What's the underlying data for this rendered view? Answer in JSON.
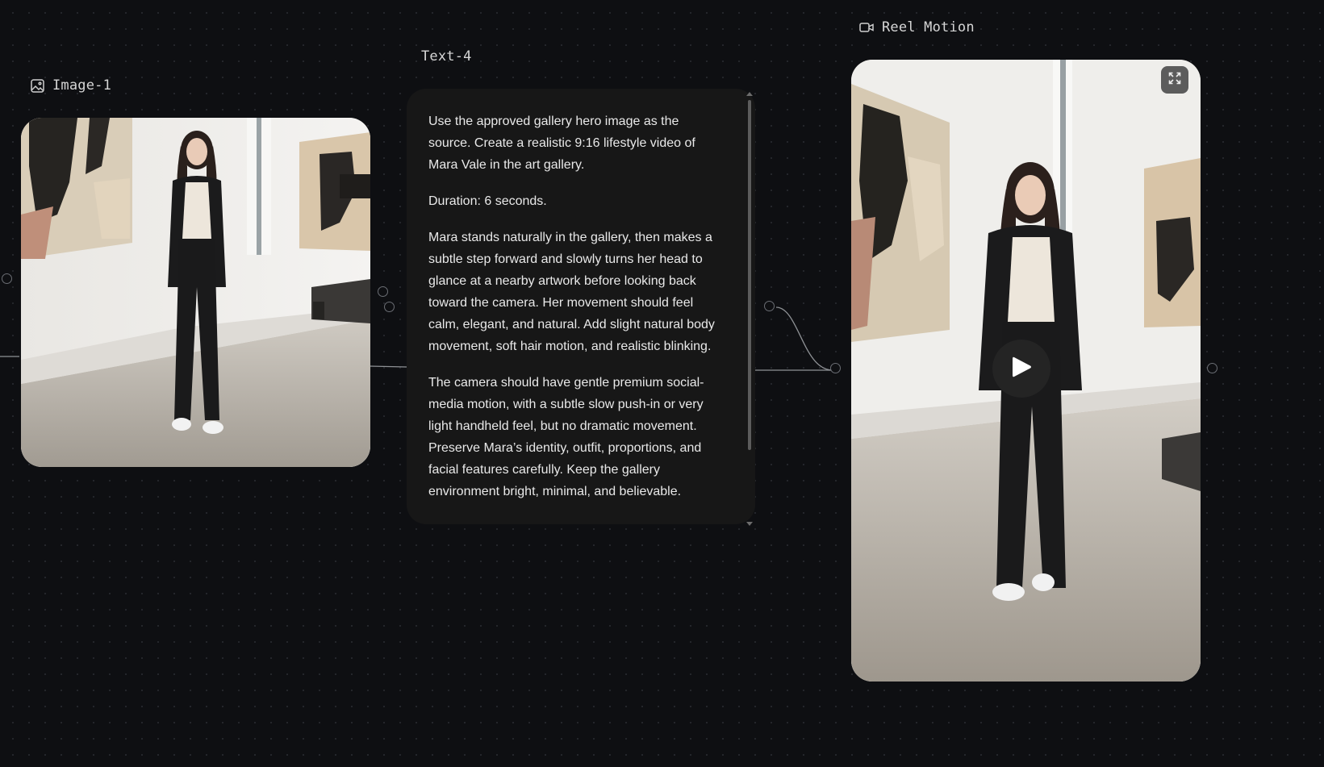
{
  "nodes": {
    "image1": {
      "title": "Image-1",
      "icon": "image-icon"
    },
    "text4": {
      "title": "Text-4",
      "paragraphs": [
        "Use the approved gallery hero image as the source. Create a realistic 9:16 lifestyle video of Mara Vale in the art gallery.",
        "Duration: 6 seconds.",
        "Mara stands naturally in the gallery, then makes a subtle step forward and slowly turns her head to glance at a nearby artwork before looking back toward the camera. Her movement should feel calm, elegant, and natural. Add slight natural body movement, soft hair motion, and realistic blinking.",
        "The camera should have gentle premium social-media motion, with a subtle slow push-in or very light handheld feel, but no dramatic movement. Preserve Mara’s identity, outfit, proportions, and facial features carefully. Keep the gallery environment bright, minimal, and believable."
      ]
    },
    "reel": {
      "title": "Reel Motion",
      "icon": "video-camera-icon",
      "expand_icon": "expand-icon",
      "play_icon": "play-icon"
    }
  },
  "colors": {
    "canvas": "#0e0f12",
    "card": "#171717",
    "edge": "#9a9a9a",
    "text": "#e9e9e9"
  }
}
